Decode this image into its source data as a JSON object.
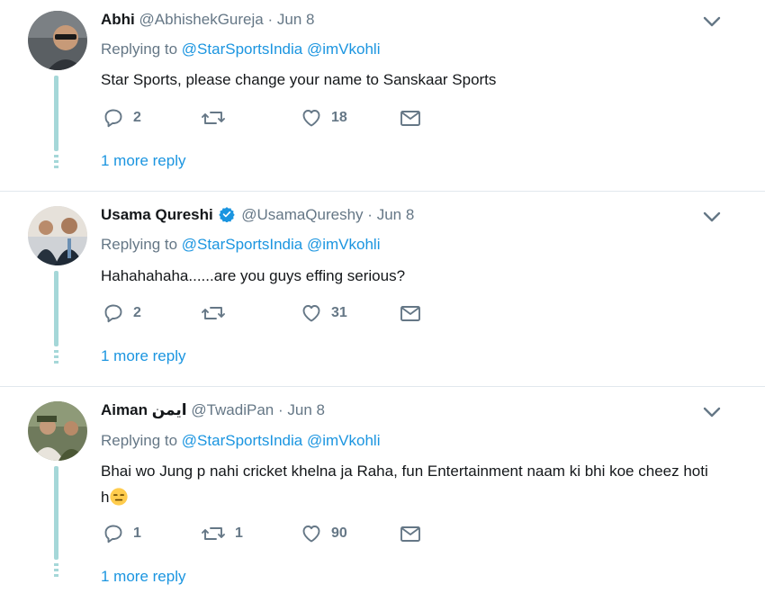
{
  "tweets": [
    {
      "name": "Abhi",
      "handle": "@AbhishekGureja",
      "separator": "·",
      "date": "Jun 8",
      "verified": false,
      "replying_label": "Replying to",
      "mentions": [
        "@StarSportsIndia",
        "@imVkohli"
      ],
      "text": "Star Sports, please change your name to Sanskaar Sports",
      "replies": "2",
      "retweets": "",
      "likes": "18",
      "more_reply": "1 more reply"
    },
    {
      "name": "Usama Qureshi",
      "handle": "@UsamaQureshy",
      "separator": "·",
      "date": "Jun 8",
      "verified": true,
      "replying_label": "Replying to",
      "mentions": [
        "@StarSportsIndia",
        "@imVkohli"
      ],
      "text": "Hahahahaha......are you guys effing serious?",
      "replies": "2",
      "retweets": "",
      "likes": "31",
      "more_reply": "1 more reply"
    },
    {
      "name": "Aiman ایمن",
      "handle": "@TwadiPan",
      "separator": "·",
      "date": "Jun 8",
      "verified": false,
      "replying_label": "Replying to",
      "mentions": [
        "@StarSportsIndia",
        "@imVkohli"
      ],
      "text": "Bhai wo Jung p nahi cricket khelna ja Raha, fun Entertainment naam ki bhi koe cheez hoti h",
      "emoji": "expressionless-face-emoji",
      "replies": "1",
      "retweets": "1",
      "likes": "90",
      "more_reply": "1 more reply"
    }
  ],
  "colors": {
    "link": "#1b95e0",
    "muted": "#657786",
    "thread_line": "#a5d7d8",
    "divider": "#e1e8ed",
    "text": "#14171a"
  },
  "icons": {
    "reply": "reply-icon",
    "retweet": "retweet-icon",
    "like": "heart-icon",
    "dm": "envelope-icon",
    "menu": "chevron-down-icon",
    "verified": "verified-badge-icon"
  }
}
